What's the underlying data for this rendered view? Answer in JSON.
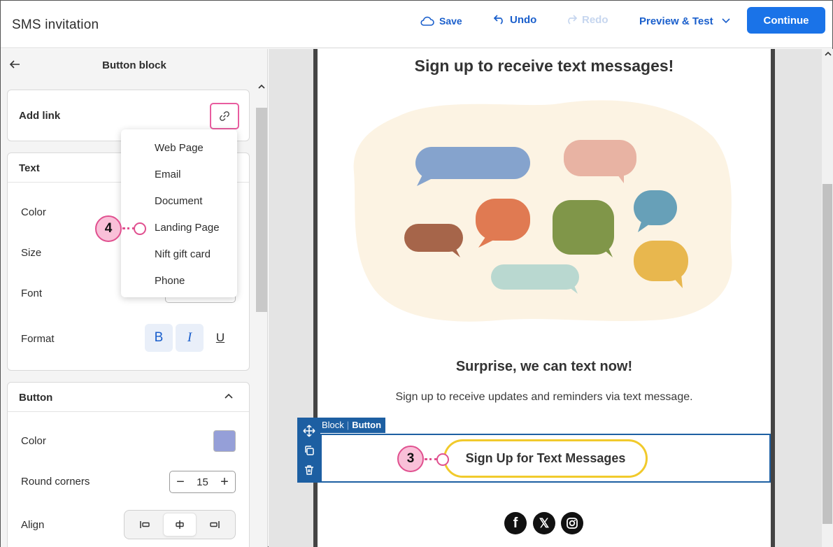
{
  "app": {
    "title": "SMS invitation"
  },
  "toolbar": {
    "save_label": "Save",
    "undo_label": "Undo",
    "redo_label": "Redo",
    "preview_label": "Preview & Test",
    "continue_label": "Continue"
  },
  "left_panel": {
    "title": "Button block",
    "add_link": {
      "label": "Add link"
    },
    "link_menu": {
      "items": [
        "Web Page",
        "Email",
        "Document",
        "Landing Page",
        "Nift gift card",
        "Phone"
      ]
    },
    "text_section": {
      "label": "Text",
      "color_label": "Color",
      "size_label": "Size",
      "font_label": "Font",
      "format_label": "Format",
      "bold_glyph": "B",
      "italic_glyph": "I",
      "underline_glyph": "U"
    },
    "button_section": {
      "label": "Button",
      "color_label": "Color",
      "color_value": "#959fd8",
      "round_corners_label": "Round corners",
      "round_corners_value": "15",
      "minus_glyph": "−",
      "plus_glyph": "+",
      "align_label": "Align"
    }
  },
  "email": {
    "heading": "Sign up to receive text messages!",
    "subheading": "Surprise, we can text now!",
    "body_text": "Sign up to receive updates and reminders via text message.",
    "block_label": {
      "block": "Block",
      "sep": "|",
      "type": "Button"
    },
    "button_label": "Sign Up for Text Messages",
    "social": {
      "facebook": "f",
      "x": "𝕏"
    }
  },
  "callouts": {
    "link_menu_callout": "4",
    "button_callout": "3"
  },
  "colors": {
    "accent": "#1a73e8",
    "callout_pink": "#e0508f",
    "block_blue": "#1d5fa2",
    "button_border": "#f1ca2c"
  }
}
